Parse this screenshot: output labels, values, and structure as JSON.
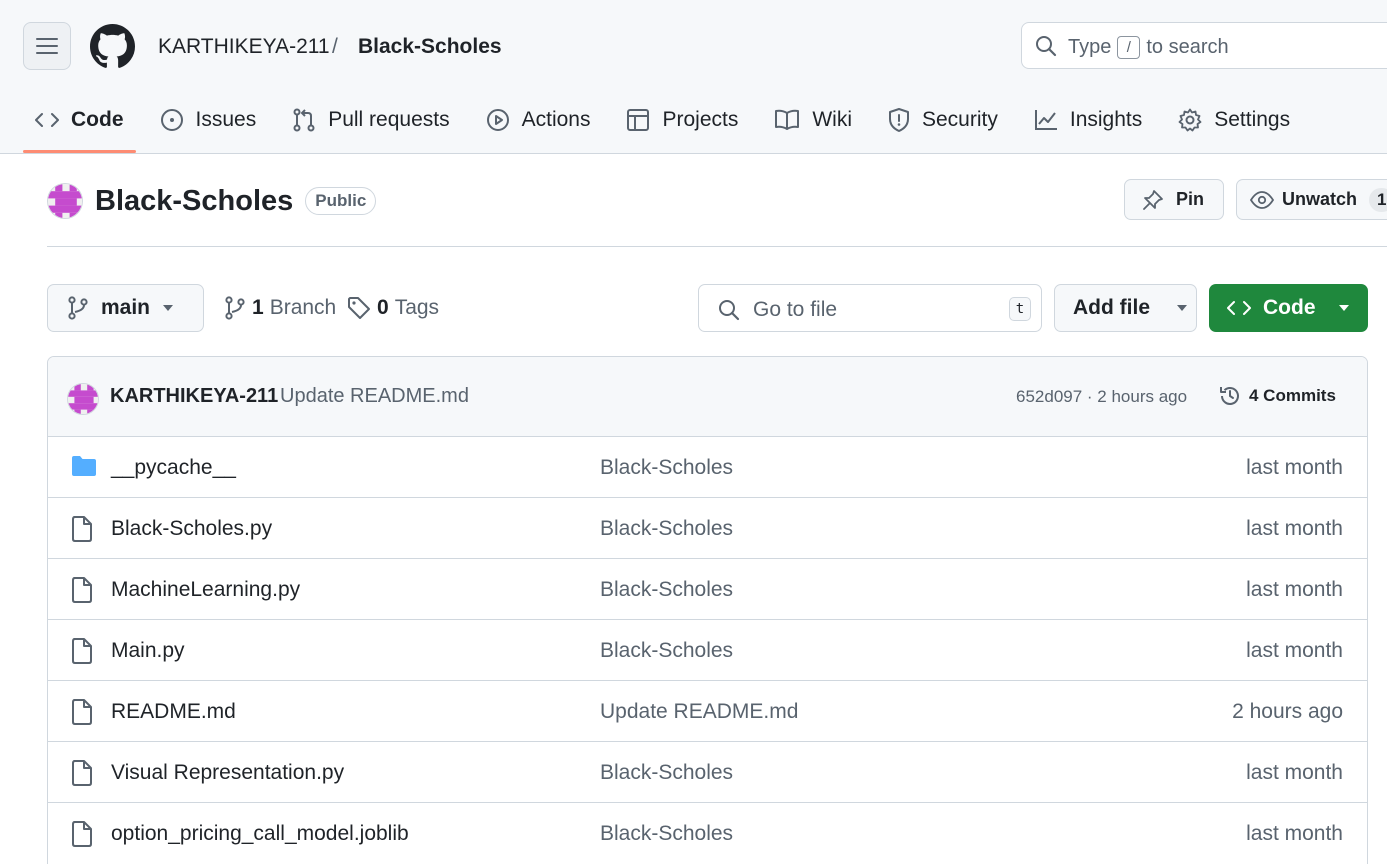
{
  "header": {
    "owner": "KARTHIKEYA-211",
    "separator": "/",
    "repo": "Black-Scholes",
    "search_prefix": "Type",
    "search_key": "/",
    "search_suffix": "to search"
  },
  "tabs": [
    {
      "label": "Code",
      "icon": "code-icon",
      "active": true
    },
    {
      "label": "Issues",
      "icon": "issue-icon"
    },
    {
      "label": "Pull requests",
      "icon": "pull-request-icon"
    },
    {
      "label": "Actions",
      "icon": "play-icon"
    },
    {
      "label": "Projects",
      "icon": "table-icon"
    },
    {
      "label": "Wiki",
      "icon": "book-icon"
    },
    {
      "label": "Security",
      "icon": "shield-icon"
    },
    {
      "label": "Insights",
      "icon": "graph-icon"
    },
    {
      "label": "Settings",
      "icon": "gear-icon"
    }
  ],
  "repo_header": {
    "title": "Black-Scholes",
    "visibility": "Public",
    "pin_label": "Pin",
    "watch_label": "Unwatch",
    "watch_count": "1"
  },
  "toolbar": {
    "branch": "main",
    "branches_count": "1",
    "branches_label": "Branch",
    "tags_count": "0",
    "tags_label": "Tags",
    "goto_placeholder": "Go to file",
    "goto_key": "t",
    "add_file_label": "Add file",
    "code_label": "Code"
  },
  "latest_commit": {
    "author": "KARTHIKEYA-211",
    "message": "Update README.md",
    "hash_time": "652d097 · 2 hours ago",
    "commits_label": "4 Commits"
  },
  "files": [
    {
      "name": "__pycache__",
      "type": "folder",
      "message": "Black-Scholes",
      "date": "last month"
    },
    {
      "name": "Black-Scholes.py",
      "type": "file",
      "message": "Black-Scholes",
      "date": "last month"
    },
    {
      "name": "MachineLearning.py",
      "type": "file",
      "message": "Black-Scholes",
      "date": "last month"
    },
    {
      "name": "Main.py",
      "type": "file",
      "message": "Black-Scholes",
      "date": "last month"
    },
    {
      "name": "README.md",
      "type": "file",
      "message": "Update README.md",
      "date": "2 hours ago"
    },
    {
      "name": "Visual Representation.py",
      "type": "file",
      "message": "Black-Scholes",
      "date": "last month"
    },
    {
      "name": "option_pricing_call_model.joblib",
      "type": "file",
      "message": "Black-Scholes",
      "date": "last month"
    }
  ],
  "colors": {
    "accent_underline": "#fd8c73",
    "primary_button": "#1f883d",
    "folder": "#54aeff",
    "avatar_identicon": "#c54bce"
  }
}
